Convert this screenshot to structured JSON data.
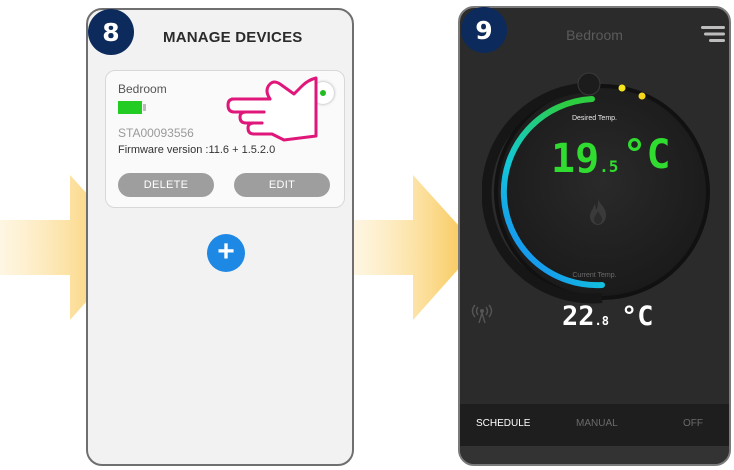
{
  "steps": {
    "left": "8",
    "right": "9"
  },
  "manage_devices": {
    "title": "MANAGE DEVICES",
    "device": {
      "name": "Bedroom",
      "serial": "STA00093556",
      "firmware": "Firmware version :11.6 + 1.5.2.0",
      "delete_label": "DELETE",
      "edit_label": "EDIT",
      "battery_color": "#22cc22",
      "status_color": "#22bb22"
    },
    "add_label": "+",
    "accent": "#1e88e5",
    "pointer_icon": "hand-pointer-icon"
  },
  "thermostat": {
    "room": "Bedroom",
    "desired_label": "Desired Temp.",
    "desired_whole": "19",
    "desired_decimal": ".5",
    "desired_unit": "°C",
    "current_label": "Current Temp.",
    "current_whole": "22",
    "current_decimal": ".8",
    "current_unit": "°C",
    "tabs": [
      "SCHEDULE",
      "MANUAL",
      "OFF"
    ],
    "active_tab": "SCHEDULE",
    "footer_text": "",
    "icons": [
      "menu-icon",
      "flame-icon",
      "wifi-signal-icon"
    ],
    "desired_color": "#2fdc2f"
  },
  "colors": {
    "badge": "#0d2a5c",
    "arrow": "#f9c94a"
  }
}
